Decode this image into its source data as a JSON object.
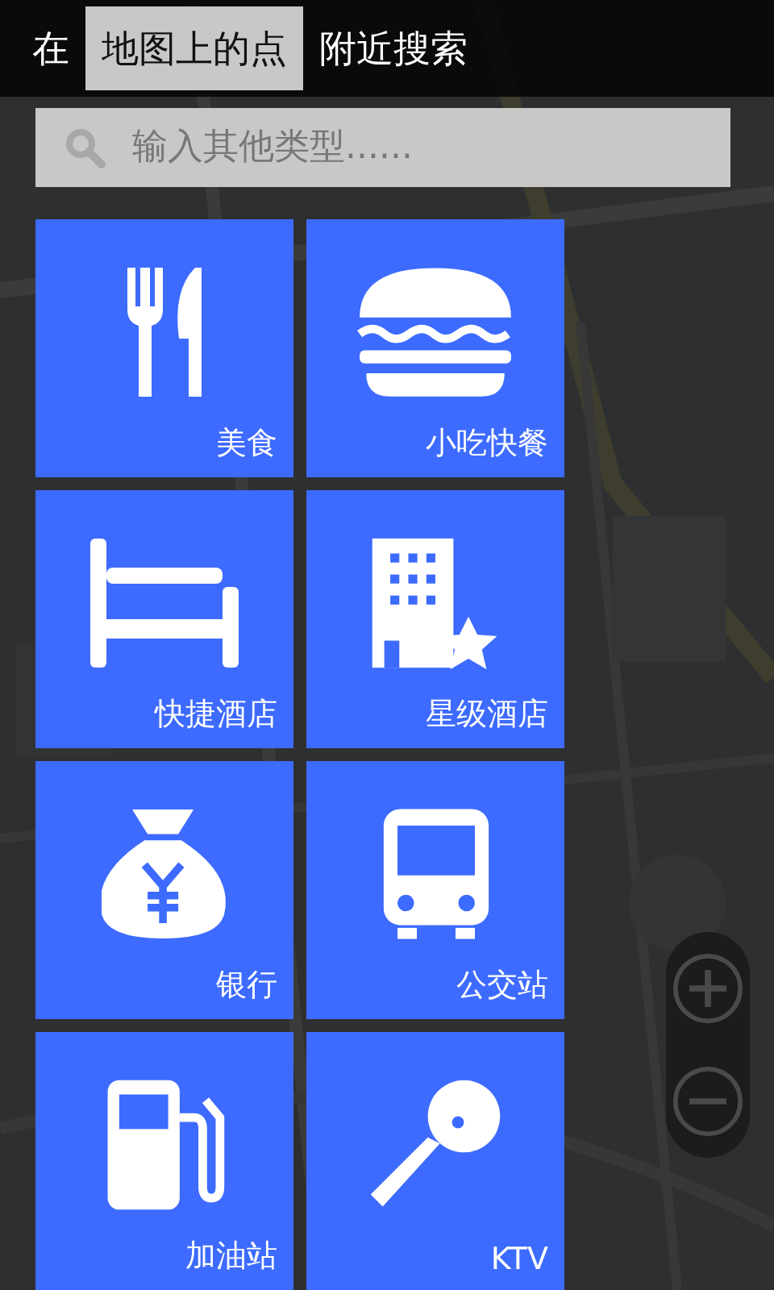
{
  "header": {
    "prefix": "在",
    "location": "地图上的点",
    "suffix": "附近搜索"
  },
  "search": {
    "placeholder": "输入其他类型......"
  },
  "categories": [
    {
      "label": "美食"
    },
    {
      "label": "小吃快餐"
    },
    {
      "label": "快捷酒店"
    },
    {
      "label": "星级酒店"
    },
    {
      "label": "银行"
    },
    {
      "label": "公交站"
    },
    {
      "label": "加油站"
    },
    {
      "label": "KTV"
    }
  ]
}
